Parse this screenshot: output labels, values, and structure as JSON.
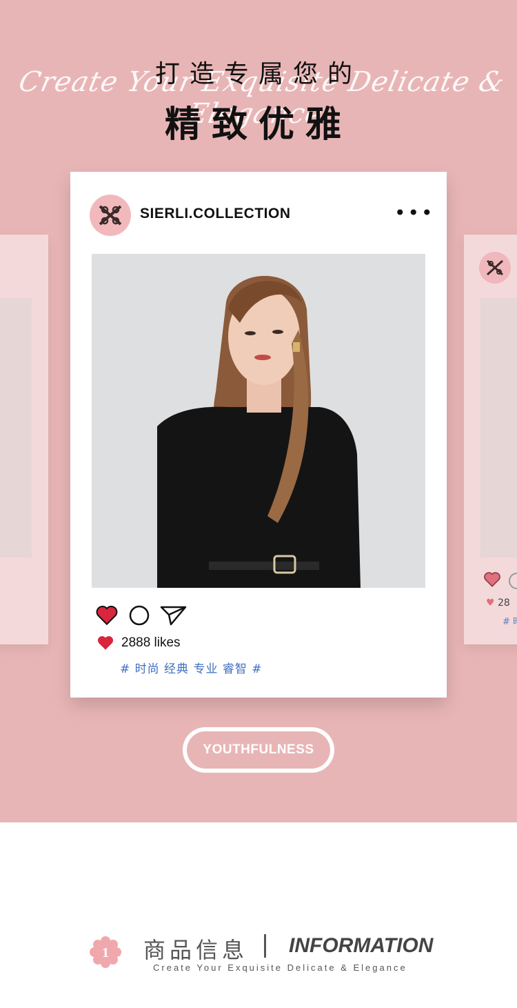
{
  "hero": {
    "title_line1": "打造专属您的",
    "title_line2": "精致优雅",
    "script_text": "Create Your Exquisite Delicate & Elegance",
    "background_color": "#e8b5b6"
  },
  "post": {
    "handle": "SIERLI.COLLECTION",
    "more_label": "•••",
    "likes": "2888 likes",
    "tags": "# 时尚 经典 专业 睿智 #",
    "heart_color": "#d7263d",
    "tag_color": "#3d6fc0",
    "icons": [
      "heart-icon",
      "comment-icon",
      "share-icon",
      "more-icon",
      "brand-logo"
    ]
  },
  "side_post": {
    "likes_partial": "28",
    "tag_partial": "# 时"
  },
  "badge": {
    "label": "YOUTHFULNESS"
  },
  "section": {
    "number": "1",
    "title_cn": "商品信息",
    "title_en": "INFORMATION",
    "subtitle": "Create Your Exquisite Delicate & Elegance",
    "accent_color": "#f0a8ad"
  }
}
